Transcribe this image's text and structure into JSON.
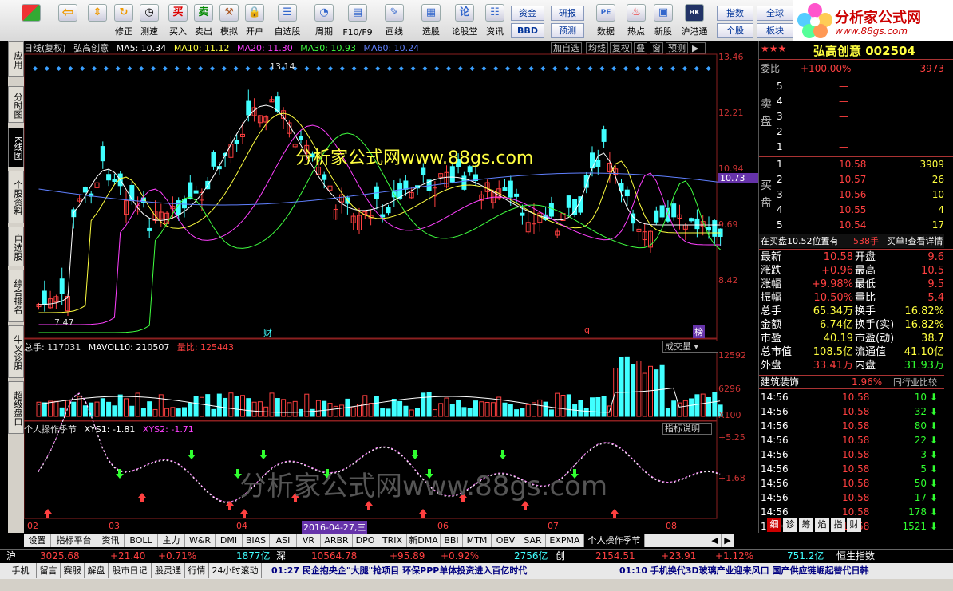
{
  "toolbar": {
    "buttons": [
      {
        "label": "",
        "icon": "windows-grid-icon"
      },
      {
        "label": "",
        "icon": "back-arrow-icon"
      },
      {
        "label": "",
        "icon": "up-down-arrow-icon"
      },
      {
        "label": "修正",
        "icon": "refresh-icon"
      },
      {
        "label": "测速",
        "icon": "clock-icon"
      },
      {
        "label": "买入",
        "icon": "buy-icon",
        "glyph": "买"
      },
      {
        "label": "卖出",
        "icon": "sell-icon",
        "glyph": "卖"
      },
      {
        "label": "模拟",
        "icon": "hammer-icon"
      },
      {
        "label": "开户",
        "icon": "lock-icon"
      },
      {
        "label": "自选股",
        "icon": "star-list-icon"
      },
      {
        "label": "周期",
        "icon": "cycle-icon"
      },
      {
        "label": "F10/F9",
        "icon": "f10-icon"
      },
      {
        "label": "画线",
        "icon": "pen-icon"
      },
      {
        "label": "选股",
        "icon": "screen-icon"
      },
      {
        "label": "论股堂",
        "icon": "forum-icon",
        "glyph": "论"
      },
      {
        "label": "资讯",
        "icon": "news-icon"
      },
      {
        "label": "数据",
        "icon": "pe-icon",
        "glyph": "PE"
      },
      {
        "label": "热点",
        "icon": "fire-icon"
      },
      {
        "label": "新股",
        "icon": "ipo-icon"
      },
      {
        "label": "沪港通",
        "icon": "hk-connect-icon"
      }
    ],
    "small_buttons": [
      "资金",
      "研报",
      "BBD",
      "预测",
      "指数",
      "全球",
      "个股",
      "板块"
    ]
  },
  "logo": {
    "line1": "分析家公式网",
    "line2": "www.88gs.com"
  },
  "left_tabs": [
    "应用",
    "分时图",
    "K线图",
    "个股资料",
    "自选股",
    "综合排名",
    "牛叉诊股",
    "超级盘口"
  ],
  "chart": {
    "header": {
      "period": "日线(复权)",
      "name": "弘高创意",
      "ma5": "MA5: 10.34",
      "ma10": "MA10: 11.12",
      "ma20": "MA20: 11.30",
      "ma30": "MA30: 10.93",
      "ma60": "MA60: 10.24"
    },
    "func_buttons": [
      "加自选",
      "均线",
      "复权",
      "叠",
      "窗",
      "预测"
    ],
    "price_axis": [
      "13.46",
      "12.21",
      "10.94",
      "10.73",
      "9.69",
      "8.42"
    ],
    "annotations": {
      "high": "13.14",
      "low": "7.47",
      "cai": "财",
      "q": "q",
      "bang": "榜"
    },
    "watermark_main": "分析家公式网www.88gs.com",
    "watermark_low": "分析家公式网www.88gs.com",
    "volume": {
      "header_total": "总手: 117031",
      "header_mavol": "MAVOL10: 210507",
      "header_ratio": "量比: 125443",
      "dropdown": "成交量",
      "axis": [
        "12592",
        "6296",
        "X100"
      ]
    },
    "indicator": {
      "name": "个人操作季节",
      "xys1": "XYS1: -1.81",
      "xys2": "XYS2: -1.71",
      "help": "指标说明",
      "axis": [
        "+5.25",
        "+1.68"
      ]
    },
    "date_labels": [
      "02",
      "03",
      "04",
      "06",
      "07",
      "08"
    ],
    "cursor_date": "2016-04-27,三"
  },
  "bottom_tabs": [
    "设置",
    "指标平台",
    "资讯",
    "BOLL",
    "主力",
    "W&R",
    "DMI",
    "BIAS",
    "ASI",
    "VR",
    "ARBR",
    "DPO",
    "TRIX",
    "新DMA",
    "BBI",
    "MTM",
    "OBV",
    "SAR",
    "EXPMA",
    "个人操作季节"
  ],
  "right": {
    "stock_name": "弘高创意",
    "stock_code": "002504",
    "weibi_label": "委比",
    "weibi_value": "+100.00%",
    "weibi_diff": "3973",
    "sell_label": "卖盘",
    "buy_label": "买盘",
    "sells": [
      {
        "n": "5",
        "p": "—",
        "v": ""
      },
      {
        "n": "4",
        "p": "—",
        "v": ""
      },
      {
        "n": "3",
        "p": "—",
        "v": ""
      },
      {
        "n": "2",
        "p": "—",
        "v": ""
      },
      {
        "n": "1",
        "p": "—",
        "v": ""
      }
    ],
    "buys": [
      {
        "n": "1",
        "p": "10.58",
        "v": "3909"
      },
      {
        "n": "2",
        "p": "10.57",
        "v": "26"
      },
      {
        "n": "3",
        "p": "10.56",
        "v": "10"
      },
      {
        "n": "4",
        "p": "10.55",
        "v": "4"
      },
      {
        "n": "5",
        "p": "10.54",
        "v": "17"
      }
    ],
    "notice": "在买盘10.52位置有",
    "notice_vol": "538手",
    "notice_link": "买单!查看详情",
    "stats": [
      [
        "最新",
        "10.58",
        "开盘",
        "9.6"
      ],
      [
        "涨跌",
        "+0.96",
        "最高",
        "10.5"
      ],
      [
        "涨幅",
        "+9.98%",
        "最低",
        "9.5"
      ],
      [
        "振幅",
        "10.50%",
        "量比",
        "5.4"
      ],
      [
        "总手",
        "65.34万",
        "换手",
        "16.82%"
      ],
      [
        "金额",
        "6.74亿",
        "换手(实)",
        "16.82%"
      ],
      [
        "市盈",
        "40.19",
        "市盈(动)",
        "38.7"
      ],
      [
        "总市值",
        "108.5亿",
        "流通值",
        "41.10亿"
      ],
      [
        "外盘",
        "33.41万",
        "内盘",
        "31.93万"
      ]
    ],
    "sector": "建筑装饰",
    "sector_chg": "1.96%",
    "sector_link": "同行业比较",
    "ticks": [
      {
        "t": "14:56",
        "p": "10.58",
        "v": "10"
      },
      {
        "t": "14:56",
        "p": "10.58",
        "v": "32"
      },
      {
        "t": "14:56",
        "p": "10.58",
        "v": "80"
      },
      {
        "t": "14:56",
        "p": "10.58",
        "v": "22"
      },
      {
        "t": "14:56",
        "p": "10.58",
        "v": "3"
      },
      {
        "t": "14:56",
        "p": "10.58",
        "v": "5"
      },
      {
        "t": "14:56",
        "p": "10.58",
        "v": "50"
      },
      {
        "t": "14:56",
        "p": "10.58",
        "v": "17"
      },
      {
        "t": "14:56",
        "p": "10.58",
        "v": "178"
      },
      {
        "t": "15:00",
        "p": "10.58",
        "v": "1521"
      }
    ],
    "tabs": [
      "细",
      "诊",
      "筹",
      "焰",
      "指",
      "财"
    ]
  },
  "status": {
    "sh_label": "沪",
    "sh_index": "3025.68",
    "sh_chg": "+21.40",
    "sh_pct": "+0.71%",
    "sh_amt": "1877亿",
    "sz_label": "深",
    "sz_index": "10564.78",
    "sz_chg": "+95.89",
    "sz_pct": "+0.92%",
    "sz_amt": "2756亿",
    "cy_label": "创",
    "cy_index": "2154.51",
    "cy_chg": "+23.91",
    "cy_pct": "+1.12%",
    "cy_amt": "751.2亿",
    "hs_label": "恒生指数"
  },
  "ticker": {
    "tabs": [
      "手机",
      "留言",
      "赛服",
      "解盘",
      "股市日记",
      "股灵通",
      "行情",
      "24小时滚动"
    ],
    "news1": "01:27 民企抱央企\"大腿\"抢项目 环保PPP单体投资进入百亿时代",
    "news2": "01:10 手机换代3D玻璃产业迎来风口 国产供应链崛起替代日韩"
  },
  "colors": {
    "up": "#ff4040",
    "down": "#40ffff",
    "ma5": "#ffffff",
    "ma10": "#ffff40",
    "ma20": "#ff40ff",
    "ma30": "#40ff40",
    "ma60": "#6080ff",
    "accent": "#cc0000"
  }
}
